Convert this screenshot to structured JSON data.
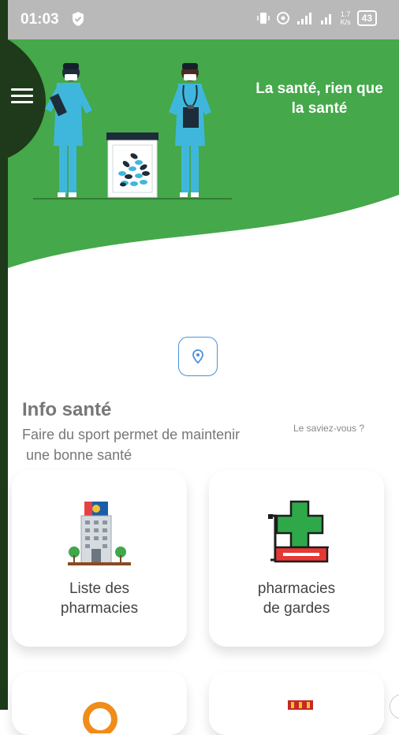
{
  "status_bar": {
    "time": "01:03",
    "network_speed_value": "1.7",
    "network_speed_unit": "K/s",
    "battery_level": "43"
  },
  "header": {
    "tagline_line1": "La santé, rien que",
    "tagline_line2": "la santé"
  },
  "info": {
    "title": "Info santé",
    "text_line1": "Faire du sport permet de maintenir",
    "text_line2": " une bonne santé",
    "link": "Le saviez-vous ?"
  },
  "cards": [
    {
      "line1": "Liste des",
      "line2": "pharmacies",
      "icon": "hospital-building-icon"
    },
    {
      "line1": "pharmacies",
      "line2": "de gardes",
      "icon": "pharmacy-cross-sign-icon"
    }
  ],
  "colors": {
    "brand_green": "#45a84a",
    "dark_rail": "#1e3a1b",
    "status_bar": "#b9b9b9",
    "scrubs": "#3fb7dc",
    "location_blue": "#4a90d9"
  }
}
